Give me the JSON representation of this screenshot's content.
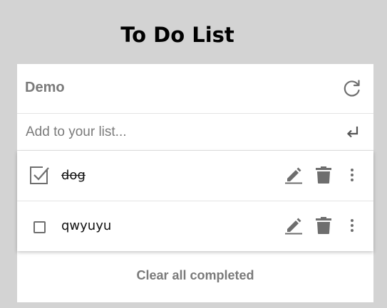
{
  "app": {
    "title": "To Do List"
  },
  "list": {
    "name": "Demo"
  },
  "add_item": {
    "placeholder": "Add to your list...",
    "value": ""
  },
  "items": [
    {
      "text": "dog",
      "completed": true
    },
    {
      "text": "qwyuyu",
      "completed": false
    }
  ],
  "footer": {
    "clear_label": "Clear all completed"
  },
  "icons": {
    "refresh": "refresh-icon",
    "enter": "enter-icon",
    "checked": "checkbox-checked-icon",
    "unchecked": "checkbox-unchecked-icon",
    "edit": "pencil-icon",
    "delete": "trash-icon",
    "more": "more-vertical-icon"
  },
  "colors": {
    "background": "#d3d3d3",
    "card": "#ffffff",
    "icon": "#6e6e6e",
    "muted_text": "#7a7a7a"
  }
}
